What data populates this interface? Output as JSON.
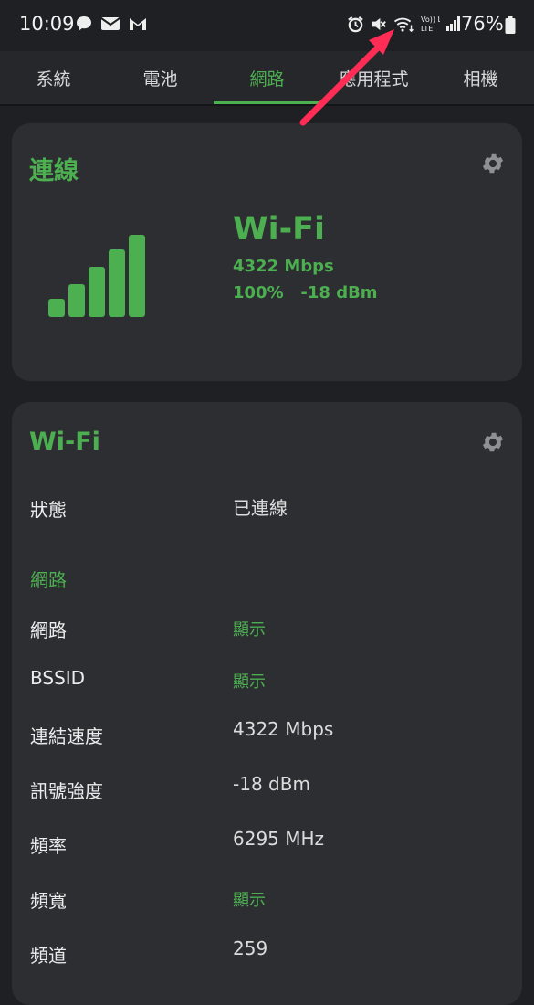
{
  "status_bar": {
    "time": "10:09",
    "left_icons": [
      "chat-icon",
      "email-icon",
      "gmail-icon"
    ],
    "right_icons": [
      "alarm-icon",
      "mute-icon",
      "wifi-icon",
      "volte-icon",
      "signal-icon"
    ],
    "volte_text": "Vo)) LTE",
    "battery": "76%"
  },
  "tabs": [
    {
      "label": "系統",
      "active": false
    },
    {
      "label": "電池",
      "active": false
    },
    {
      "label": "網路",
      "active": true
    },
    {
      "label": "應用程式",
      "active": false
    },
    {
      "label": "相機",
      "active": false
    }
  ],
  "connection_card": {
    "title": "連線",
    "type": "Wi-Fi",
    "speed": "4322 Mbps",
    "signal": "100%   -18 dBm",
    "signal_bars": 5
  },
  "wifi_card": {
    "title": "Wi-Fi",
    "status_label": "狀態",
    "status_value": "已連線",
    "network_section": "網路",
    "rows": [
      {
        "label": "網路",
        "value": "顯示",
        "link": true
      },
      {
        "label": "BSSID",
        "value": "顯示",
        "link": true
      },
      {
        "label": "連結速度",
        "value": "4322 Mbps",
        "link": false
      },
      {
        "label": "訊號強度",
        "value": "-18 dBm",
        "link": false
      },
      {
        "label": "頻率",
        "value": "6295 MHz",
        "link": false
      },
      {
        "label": "頻寬",
        "value": "顯示",
        "link": true
      },
      {
        "label": "頻道",
        "value": "259",
        "link": false
      }
    ]
  },
  "colors": {
    "accent": "#4caf50",
    "background": "#1f2023",
    "card": "#2d2e32",
    "arrow": "#ff2d55"
  }
}
